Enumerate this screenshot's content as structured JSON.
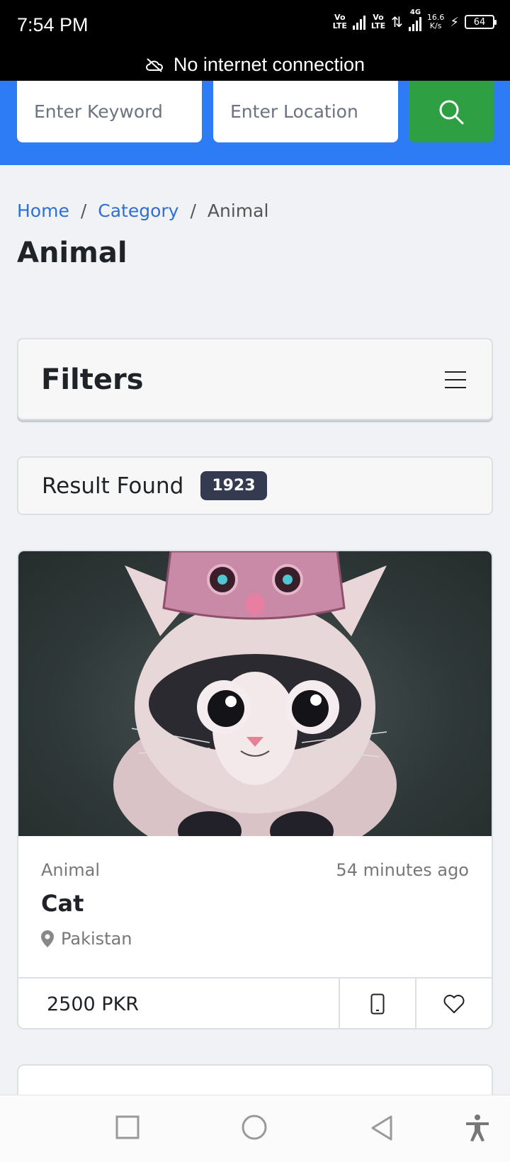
{
  "status_bar": {
    "time": "7:54 PM",
    "net1": "Vo\nLTE",
    "net2": "Vo\nLTE",
    "net3": "4G",
    "speed": "16.6\nK/s",
    "battery": "64",
    "banner": "No internet connection"
  },
  "search": {
    "keyword_placeholder": "Enter Keyword",
    "location_placeholder": "Enter Location"
  },
  "breadcrumb": {
    "home": "Home",
    "sep": "/",
    "category": "Category",
    "current": "Animal"
  },
  "page_title": "Animal",
  "filters": {
    "title": "Filters"
  },
  "result": {
    "label": "Result Found",
    "count": "1923"
  },
  "listing": {
    "category": "Animal",
    "time_ago": "54 minutes ago",
    "title": "Cat",
    "location": "Pakistan",
    "price": "2500 PKR"
  },
  "colors": {
    "header_blue": "#2d7cf6",
    "search_green": "#2ea043",
    "link_blue": "#2f6fd1",
    "badge_dark": "#343a4f"
  }
}
